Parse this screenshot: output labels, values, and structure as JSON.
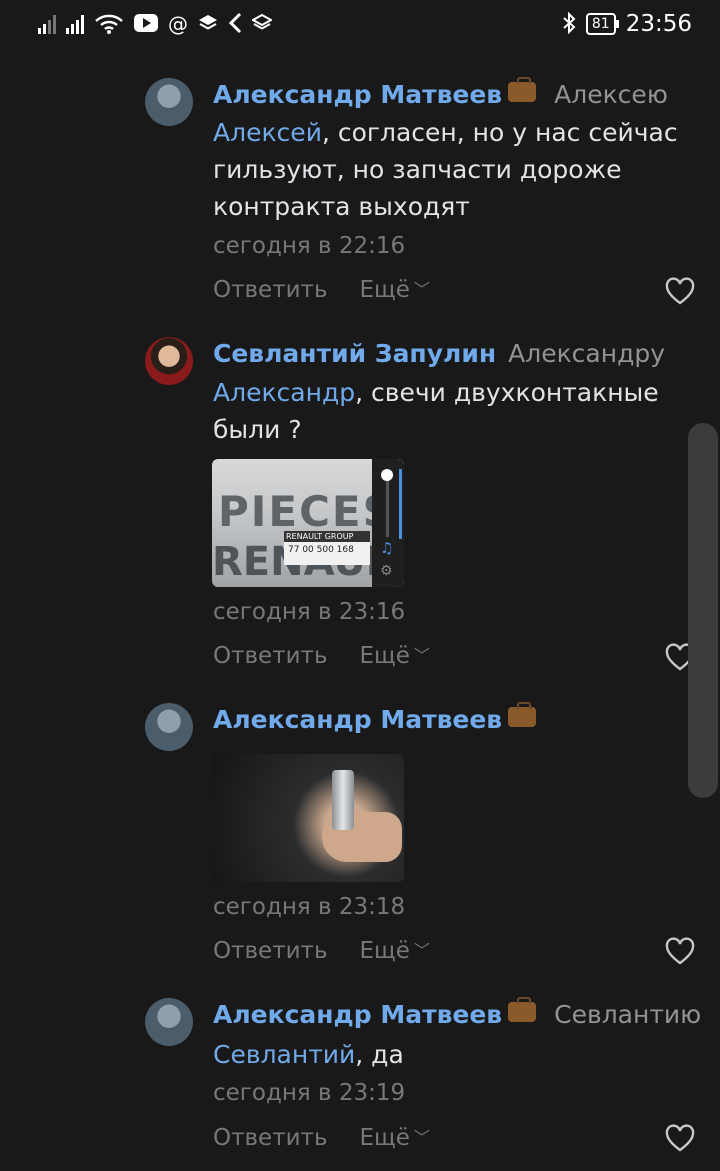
{
  "status_bar": {
    "time": "23:56",
    "battery": "81",
    "left_icons": [
      "signal-icon",
      "signal-icon",
      "wifi-icon",
      "youtube-icon",
      "at-icon",
      "layers-icon",
      "back-icon",
      "layers-icon"
    ],
    "right_icons": [
      "bluetooth-icon",
      "battery-icon"
    ]
  },
  "comments": [
    {
      "author": "Александр Матвеев",
      "badge_icon": "briefcase-icon",
      "reply_to": "Алексею",
      "mention": "Алексей",
      "text": ", согласен, но у нас сейчас гильзуют, но запчасти дороже контракта выходят",
      "time": "сегодня в 22:16",
      "reply_label": "Ответить",
      "more_label": "Ещё"
    },
    {
      "author": "Севлантий Запулин",
      "reply_to": "Александру",
      "mention": "Александр",
      "text": ", свечи двухконтакные были ?",
      "attachment": {
        "type": "photo",
        "texts": [
          "PIECES",
          "RENAULT",
          "RENAULT GROUP",
          "77 00 500 168"
        ]
      },
      "time": "сегодня в 23:16",
      "reply_label": "Ответить",
      "more_label": "Ещё"
    },
    {
      "author": "Александр Матвеев",
      "badge_icon": "briefcase-icon",
      "attachment": {
        "type": "photo"
      },
      "time": "сегодня в 23:18",
      "reply_label": "Ответить",
      "more_label": "Ещё"
    },
    {
      "author": "Александр Матвеев",
      "badge_icon": "briefcase-icon",
      "reply_to": "Севлантию",
      "mention": "Севлантий",
      "text": ", да",
      "time": "сегодня в 23:19",
      "reply_label": "Ответить",
      "more_label": "Ещё"
    }
  ],
  "colors": {
    "background": "#191919",
    "author": "#71aaeb",
    "text": "#e1e3e6",
    "secondary": "#76787a"
  }
}
